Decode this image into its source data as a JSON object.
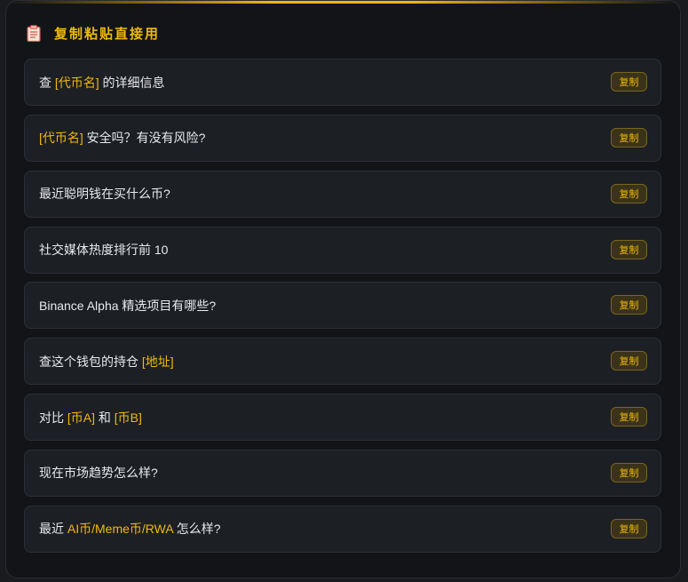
{
  "header": {
    "icon": "clipboard-icon",
    "title": "复制粘贴直接用"
  },
  "copy_label": "复制",
  "accent_color": "#f0b90b",
  "items": [
    {
      "parts": [
        {
          "t": "查 ",
          "hl": false
        },
        {
          "t": "[代币名]",
          "hl": true
        },
        {
          "t": " 的详细信息",
          "hl": false
        }
      ]
    },
    {
      "parts": [
        {
          "t": "[代币名]",
          "hl": true
        },
        {
          "t": " 安全吗？有没有风险?",
          "hl": false
        }
      ]
    },
    {
      "parts": [
        {
          "t": "最近聪明钱在买什么币?",
          "hl": false
        }
      ]
    },
    {
      "parts": [
        {
          "t": "社交媒体热度排行前 10",
          "hl": false
        }
      ]
    },
    {
      "parts": [
        {
          "t": "Binance Alpha 精选项目有哪些?",
          "hl": false
        }
      ]
    },
    {
      "parts": [
        {
          "t": "查这个钱包的持仓 ",
          "hl": false
        },
        {
          "t": "[地址]",
          "hl": true
        }
      ]
    },
    {
      "parts": [
        {
          "t": "对比 ",
          "hl": false
        },
        {
          "t": "[币A]",
          "hl": true
        },
        {
          "t": " 和 ",
          "hl": false
        },
        {
          "t": "[币B]",
          "hl": true
        }
      ]
    },
    {
      "parts": [
        {
          "t": "现在市场趋势怎么样?",
          "hl": false
        }
      ]
    },
    {
      "parts": [
        {
          "t": "最近 ",
          "hl": false
        },
        {
          "t": "AI币/Meme币/RWA",
          "hl": true
        },
        {
          "t": " 怎么样?",
          "hl": false
        }
      ]
    }
  ]
}
